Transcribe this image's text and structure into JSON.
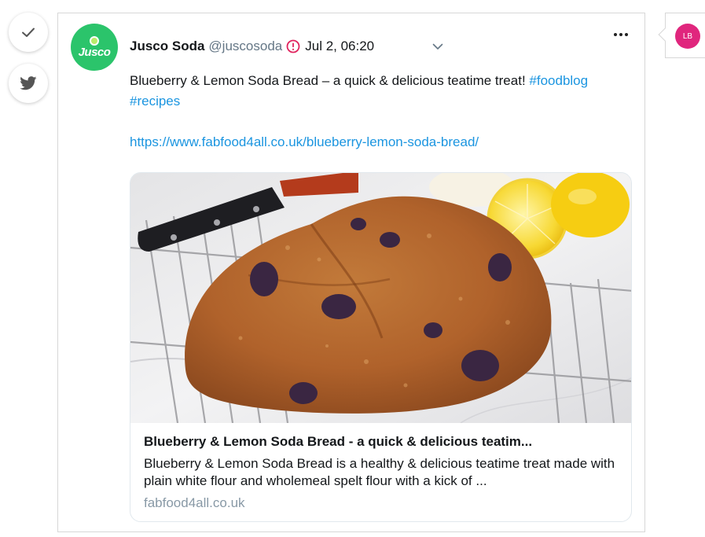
{
  "sidebar": {
    "buttons": [
      {
        "icon": "checkmark-icon"
      },
      {
        "icon": "twitter-bird-icon"
      }
    ]
  },
  "tweet": {
    "author_name": "Jusco Soda",
    "author_handle": "@juscosoda",
    "avatar_logo": "Jusco",
    "timestamp": "Jul 2, 06:20",
    "text_main": "Blueberry & Lemon Soda Bread – a quick & delicious teatime treat!",
    "hashtag_1": "#foodblog",
    "hashtag_2": "#recipes",
    "url": "https://www.fabfood4all.co.uk/blueberry-lemon-soda-bread/",
    "link_card": {
      "title": "Blueberry & Lemon Soda Bread - a quick & delicious teatim...",
      "description": "Blueberry & Lemon Soda Bread is a healthy & delicious teatime treat made with plain white flour and wholemeal spelt flour with a kick of ...",
      "domain": "fabfood4all.co.uk"
    }
  },
  "right_panel": {
    "avatar_initials": "LB"
  },
  "colors": {
    "link": "#1b95e0",
    "avatar_bg": "#2bc46b",
    "badge_pink": "#e0267d",
    "warning_red": "#e0245e"
  }
}
